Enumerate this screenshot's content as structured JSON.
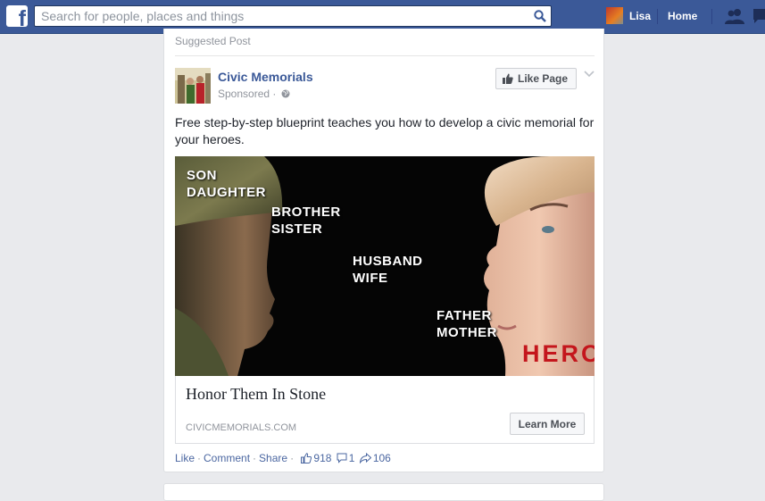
{
  "header": {
    "search_placeholder": "Search for people, places and things",
    "user_name": "Lisa",
    "home_label": "Home"
  },
  "post": {
    "label": "Suggested Post",
    "page_name": "Civic Memorials",
    "sponsored_label": "Sponsored",
    "sponsored_sep": "·",
    "like_page_label": "Like Page",
    "text": "Free step-by-step blueprint teaches you how to develop a civic memorial for your heroes.",
    "image": {
      "words": [
        {
          "line1": "SON",
          "line2": "DAUGHTER"
        },
        {
          "line1": "BROTHER",
          "line2": "SISTER"
        },
        {
          "line1": "HUSBAND",
          "line2": "WIFE"
        },
        {
          "line1": "FATHER",
          "line2": "MOTHER"
        }
      ],
      "hero": "HERO"
    },
    "link": {
      "title": "Honor Them In Stone",
      "domain": "CIVICMEMORIALS.COM",
      "cta": "Learn More"
    },
    "actions": {
      "like": "Like",
      "comment": "Comment",
      "share": "Share",
      "separator": "·",
      "like_count": "918",
      "comment_count": "1",
      "share_count": "106"
    }
  },
  "colors": {
    "brand": "#3b5998",
    "link": "#4b67a1",
    "hero_red": "#c4161c"
  }
}
